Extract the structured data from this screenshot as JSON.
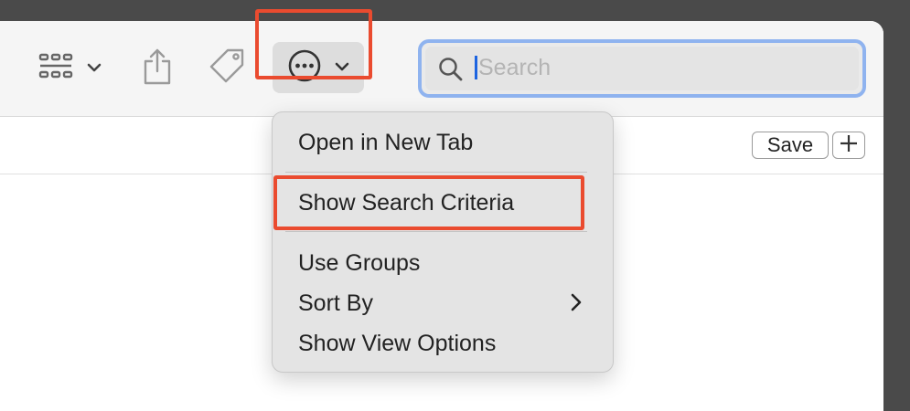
{
  "toolbar": {
    "search": {
      "placeholder": "Search",
      "value": ""
    },
    "icons": {
      "view": "grid-view-icon",
      "view_chevron": "chevron-down-icon",
      "share": "share-icon",
      "tag": "tag-icon",
      "more": "ellipsis-circle-icon",
      "more_chevron": "chevron-down-icon",
      "search": "magnifying-glass-icon"
    }
  },
  "subbar": {
    "save_label": "Save",
    "add_icon": "plus-icon"
  },
  "menu": {
    "items": [
      {
        "label": "Open in New Tab"
      },
      {
        "label": "Show Search Criteria"
      },
      {
        "label": "Use Groups"
      },
      {
        "label": "Sort By",
        "submenu_icon": "chevron-right-icon"
      },
      {
        "label": "Show View Options"
      }
    ]
  },
  "colors": {
    "highlight": "#ea4b2f",
    "search_focus_ring": "#8fb3ef",
    "caret": "#1d64e0",
    "menu_background": "#e4e4e4"
  }
}
